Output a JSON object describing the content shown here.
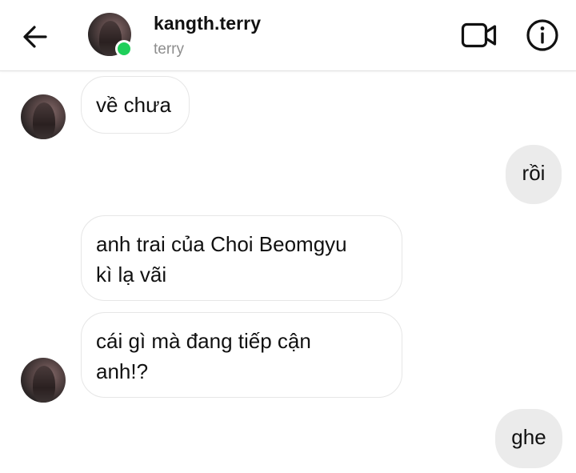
{
  "header": {
    "username": "kangth.terry",
    "subname": "terry",
    "online_color": "#1fcf5a",
    "icons": {
      "back": "arrow-left-icon",
      "video": "video-camera-icon",
      "info": "info-icon"
    }
  },
  "messages": [
    {
      "side": "in",
      "text": "về chưa"
    },
    {
      "side": "out",
      "text": "rồi"
    },
    {
      "side": "in",
      "text": "anh trai của Choi Beomgyu\nkì lạ vãi"
    },
    {
      "side": "in",
      "text": "cái gì mà đang tiếp cận\nanh!?"
    },
    {
      "side": "out",
      "text": "ghe"
    }
  ],
  "colors": {
    "incoming_bubble_bg": "#ffffff",
    "incoming_bubble_border": "#e6e6e6",
    "outgoing_bubble_bg": "#ebebeb",
    "subname_color": "#8e8e8e"
  }
}
